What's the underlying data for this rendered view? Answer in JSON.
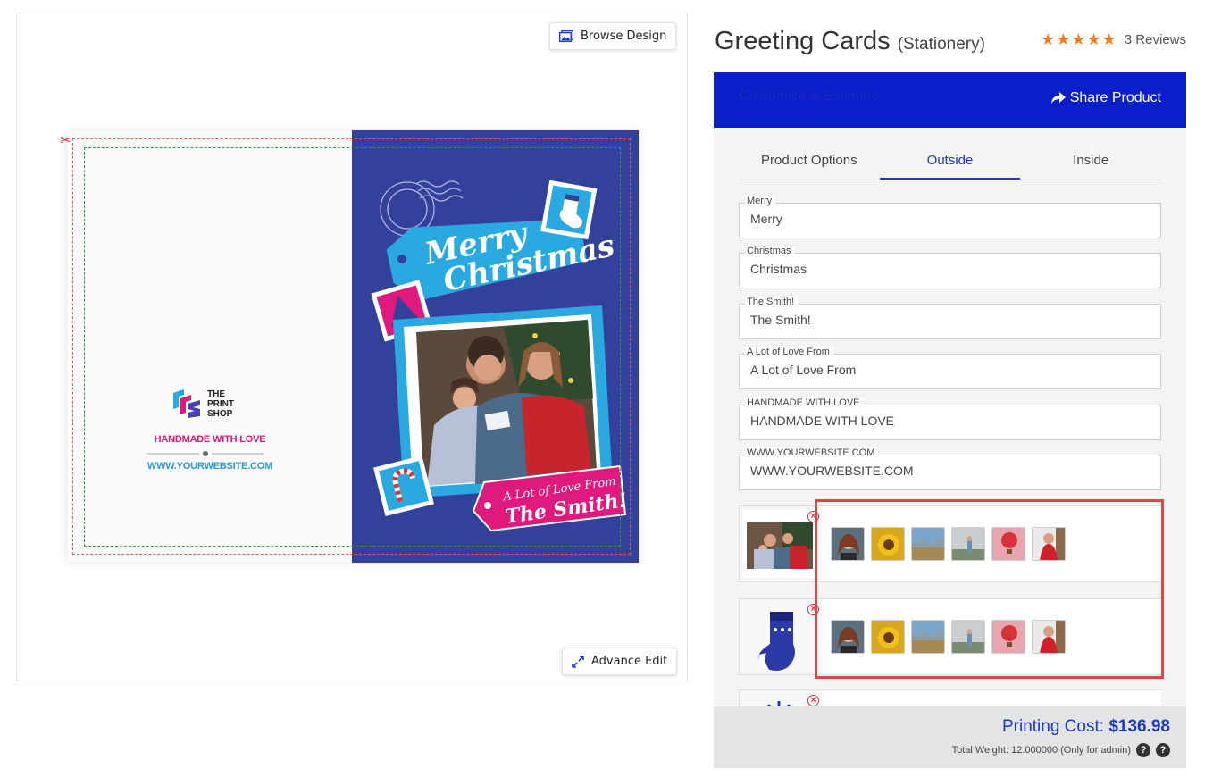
{
  "toolbar": {
    "browse_label": "Browse Design",
    "advance_label": "Advance Edit"
  },
  "card": {
    "left": {
      "logo_text": [
        "THE",
        "PRINT",
        "SHOP"
      ],
      "handmade": "HANDMADE WITH LOVE",
      "website": "WWW.YOURWEBSITE.COM"
    },
    "right": {
      "headline_1": "Merry",
      "headline_2": "Christmas",
      "tag_line_1": "A Lot of Love From",
      "tag_line_2": "The Smith!"
    }
  },
  "product": {
    "title": "Greeting Cards",
    "category": "(Stationery)",
    "stars": "★★★★★",
    "reviews": "3 Reviews"
  },
  "customize": {
    "title": "Customize & Estimate",
    "share_label": "Share Product"
  },
  "tabs": [
    {
      "label": "Product Options"
    },
    {
      "label": "Outside"
    },
    {
      "label": "Inside"
    }
  ],
  "fields": [
    {
      "label": "Merry",
      "value": "Merry"
    },
    {
      "label": "Christmas",
      "value": "Christmas"
    },
    {
      "label": "The Smith!",
      "value": "The Smith!"
    },
    {
      "label": "A Lot of Love From",
      "value": "A Lot of Love From"
    },
    {
      "label": "HANDMADE WITH LOVE",
      "value": "HANDMADE WITH LOVE"
    },
    {
      "label": "WWW.YOURWEBSITE.COM",
      "value": "WWW.YOURWEBSITE.COM"
    }
  ],
  "footer": {
    "cost_label": "Printing Cost:",
    "cost_value": "$136.98",
    "weight_text": "Total Weight: 12.000000 (Only for admin)"
  },
  "colors": {
    "brand_blue": "#0a1fc9",
    "card_blue": "#33419a",
    "accent_cyan": "#2aa9e0",
    "accent_pink": "#e0197d",
    "star_orange": "#ef7b1f",
    "highlight_red": "#e04545"
  }
}
